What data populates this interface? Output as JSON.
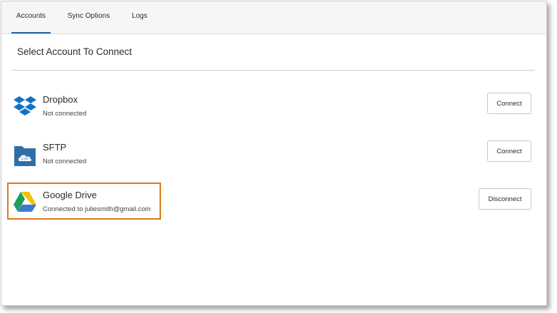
{
  "tabs": [
    {
      "label": "Accounts",
      "active": true
    },
    {
      "label": "Sync Options",
      "active": false
    },
    {
      "label": "Logs",
      "active": false
    }
  ],
  "section_title": "Select Account To Connect",
  "accounts": [
    {
      "name": "Dropbox",
      "status": "Not connected",
      "button": "Connect",
      "icon": "dropbox-icon"
    },
    {
      "name": "SFTP",
      "status": "Not connected",
      "button": "Connect",
      "icon": "sftp-folder-icon",
      "icon_text": "FTP"
    },
    {
      "name": "Google Drive",
      "status": "Connected to juliesmith@gmail.com",
      "button": "Disconnect",
      "icon": "google-drive-icon",
      "highlighted": true
    }
  ],
  "colors": {
    "active_tab_underline": "#1f5fa8",
    "highlight_border": "#d97a1e",
    "dropbox_blue": "#0d72c9",
    "sftp_blue": "#2f6fa8"
  }
}
